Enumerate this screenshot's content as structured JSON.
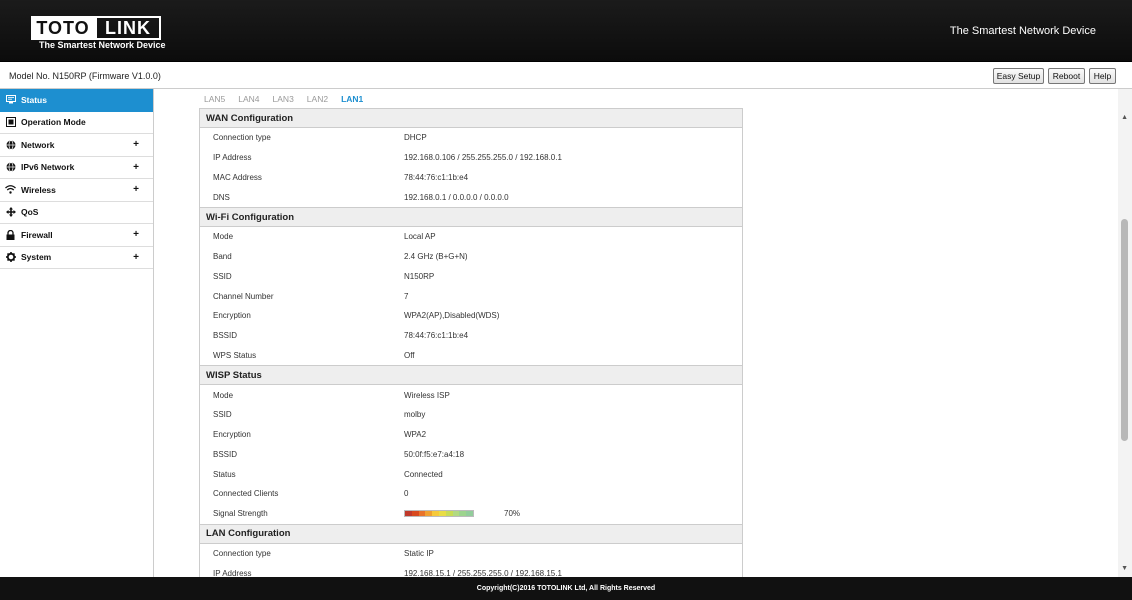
{
  "header": {
    "logo_left": "TOTO",
    "logo_right": "LINK",
    "logo_tagline": "The Smartest Network Device",
    "slogan": "The Smartest Network Device"
  },
  "modelbar": {
    "model_text": "Model No. N150RP (Firmware V1.0.0)",
    "easy_setup": "Easy Setup",
    "reboot": "Reboot",
    "help": "Help"
  },
  "sidebar": {
    "items": [
      {
        "label": "Status",
        "icon": "status-icon",
        "active": true,
        "expandable": false
      },
      {
        "label": "Operation Mode",
        "icon": "operation-mode-icon",
        "active": false,
        "expandable": false
      },
      {
        "label": "Network",
        "icon": "globe-icon",
        "active": false,
        "expandable": true
      },
      {
        "label": "IPv6 Network",
        "icon": "globe-icon",
        "active": false,
        "expandable": true
      },
      {
        "label": "Wireless",
        "icon": "wifi-icon",
        "active": false,
        "expandable": true
      },
      {
        "label": "QoS",
        "icon": "qos-icon",
        "active": false,
        "expandable": false
      },
      {
        "label": "Firewall",
        "icon": "lock-icon",
        "active": false,
        "expandable": true
      },
      {
        "label": "System",
        "icon": "gear-icon",
        "active": false,
        "expandable": true
      }
    ],
    "plus": "+"
  },
  "tabs": [
    "LAN5",
    "LAN4",
    "LAN3",
    "LAN2",
    "LAN1"
  ],
  "active_tab": "LAN1",
  "sections": {
    "wan": {
      "title": "WAN Configuration",
      "rows": [
        {
          "label": "Connection type",
          "value": "DHCP"
        },
        {
          "label": "IP Address",
          "value": "192.168.0.106 / 255.255.255.0 / 192.168.0.1"
        },
        {
          "label": "MAC Address",
          "value": "78:44:76:c1:1b:e4"
        },
        {
          "label": "DNS",
          "value": "192.168.0.1 / 0.0.0.0 / 0.0.0.0"
        }
      ]
    },
    "wifi": {
      "title": "Wi-Fi Configuration",
      "rows": [
        {
          "label": "Mode",
          "value": "Local AP"
        },
        {
          "label": "Band",
          "value": "2.4 GHz (B+G+N)"
        },
        {
          "label": "SSID",
          "value": "N150RP"
        },
        {
          "label": "Channel Number",
          "value": "7"
        },
        {
          "label": "Encryption",
          "value": "WPA2(AP),Disabled(WDS)"
        },
        {
          "label": "BSSID",
          "value": "78:44:76:c1:1b:e4"
        },
        {
          "label": "WPS Status",
          "value": "Off"
        }
      ]
    },
    "wisp": {
      "title": "WISP Status",
      "rows": [
        {
          "label": "Mode",
          "value": "Wireless ISP"
        },
        {
          "label": "SSID",
          "value": "molby"
        },
        {
          "label": "Encryption",
          "value": "WPA2"
        },
        {
          "label": "BSSID",
          "value": "50:0f:f5:e7:a4:18"
        },
        {
          "label": "Status",
          "value": "Connected"
        },
        {
          "label": "Connected Clients",
          "value": "0"
        }
      ],
      "signal_label": "Signal Strength",
      "signal_value": "70%",
      "signal_fraction": 0.7,
      "signal_colors": [
        "#c0392b",
        "#d84a1f",
        "#e8732a",
        "#f0a030",
        "#f6c93a",
        "#e9dd45",
        "#c8dc55",
        "#a4d46c",
        "#8ccc7a",
        "#7fc48a"
      ]
    },
    "lan": {
      "title": "LAN Configuration",
      "rows": [
        {
          "label": "Connection type",
          "value": "Static IP"
        },
        {
          "label": "IP Address",
          "value": "192.168.15.1 / 255.255.255.0 / 192.168.15.1"
        }
      ]
    }
  },
  "footer": "Copyright(C)2016 TOTOLINK Ltd, All Rights Reserved"
}
